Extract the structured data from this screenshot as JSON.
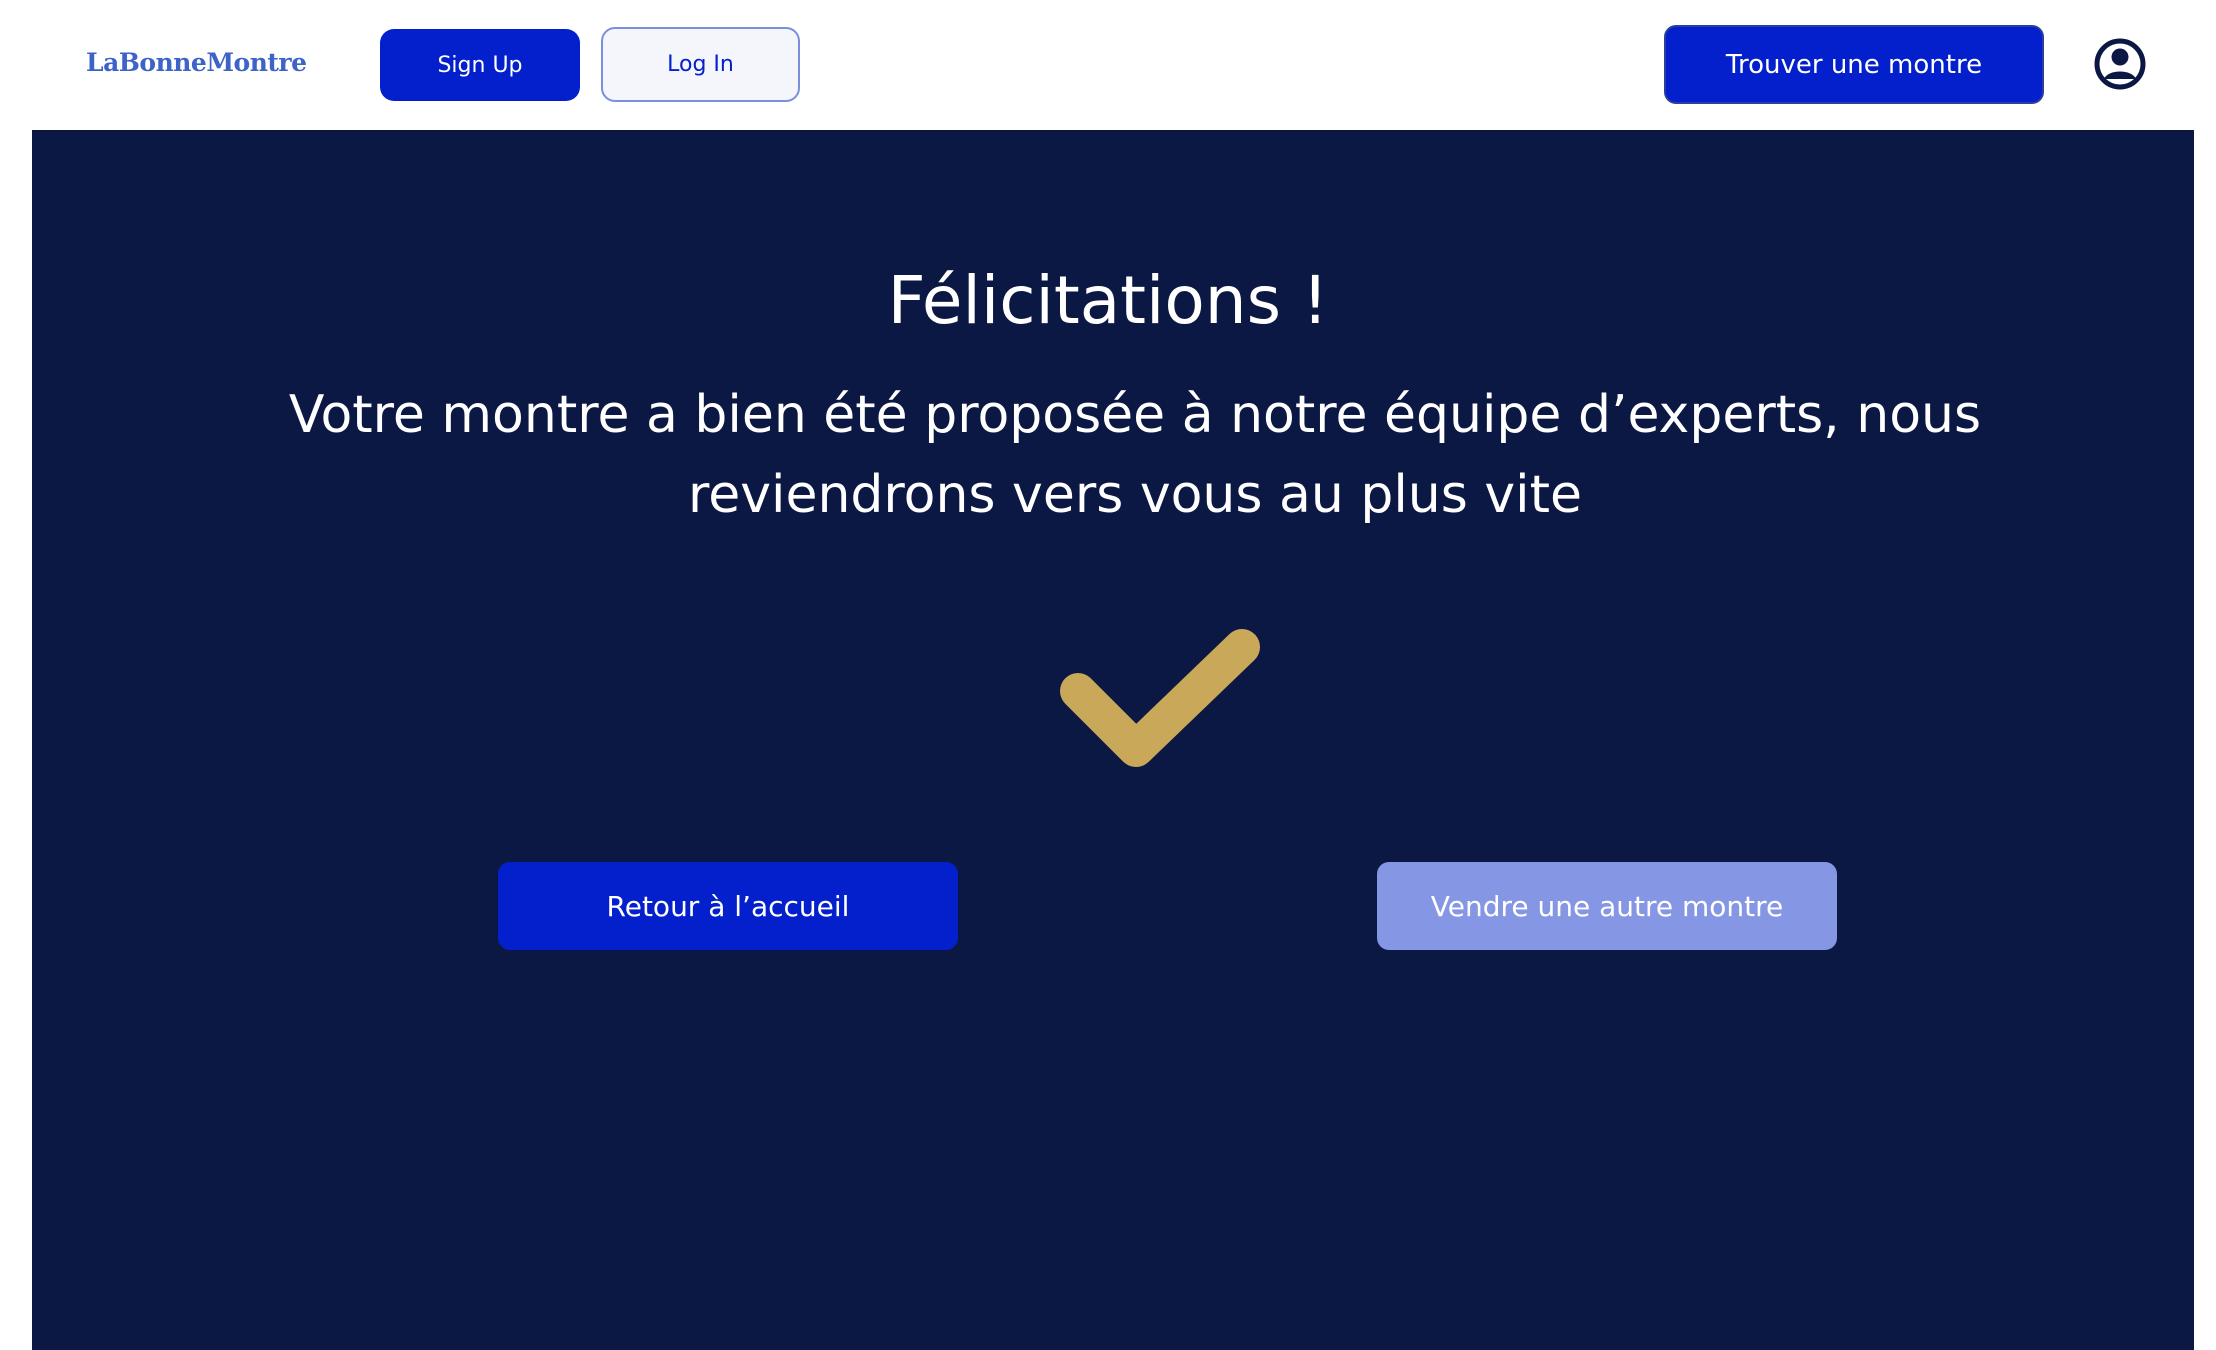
{
  "header": {
    "logo": "LaBonneMontre",
    "signup_label": "Sign Up",
    "login_label": "Log In",
    "find_watch_label": "Trouver une montre",
    "profile_icon": "user-circle-icon"
  },
  "main": {
    "title": "Félicitations !",
    "message": "Votre montre a bien été proposée à notre équipe d’experts, nous reviendrons vers vous au plus vite",
    "success_icon": "checkmark-icon",
    "home_button_label": "Retour à l’accueil",
    "sell_another_label": "Vendre une autre montre"
  },
  "colors": {
    "primary": "#0420cc",
    "panel_background": "#0c1844",
    "secondary_button": "#8596e4",
    "checkmark": "#c9a85a",
    "logo": "#3e63c8"
  }
}
